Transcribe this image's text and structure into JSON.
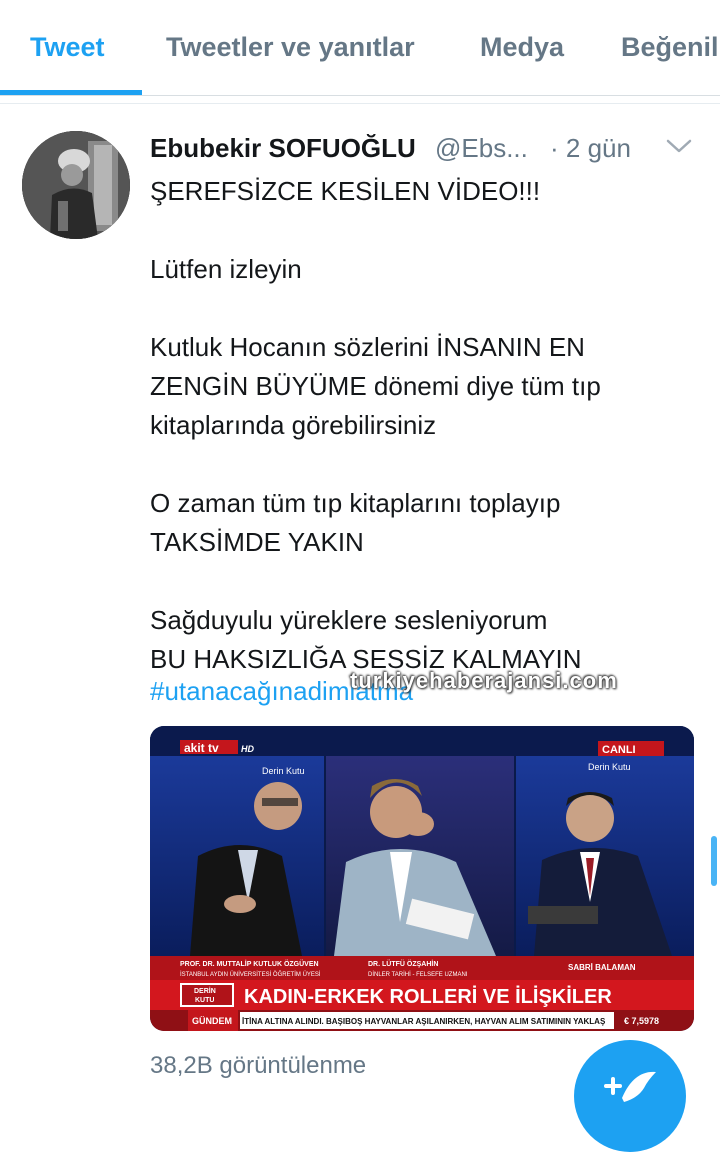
{
  "tabs": [
    {
      "label": "Tweet",
      "active": true
    },
    {
      "label": "Tweetler ve yanıtlar",
      "active": false
    },
    {
      "label": "Medya",
      "active": false
    },
    {
      "label": "Beğenil",
      "active": false
    }
  ],
  "tweet": {
    "author_name": "Ebubekir SOFUOĞLU",
    "handle": "@Ebs...",
    "time": "· 2 gün",
    "lines": [
      "ŞEREFSİZCE KESİLEN VİDEO!!!",
      "",
      "Lütfen izleyin",
      "",
      "Kutluk Hocanın sözlerini İNSANIN EN",
      "ZENGİN BÜYÜME dönemi diye tüm tıp",
      "kitaplarında görebilirsiniz",
      "",
      "O zaman tüm tıp kitaplarını toplayıp",
      "TAKSİMDE YAKIN",
      "",
      "Sağduyulu yüreklere sesleniyorum",
      "BU HAKSIZLIĞA SESSİZ KALMAYIN"
    ],
    "hashtag": "#utanacağınadimlatma",
    "views": "38,2B görüntülenme"
  },
  "watermark": "turkiyehaberajansi.com",
  "video": {
    "channel_logo": "akit tv",
    "hd": "HD",
    "live": "CANLI",
    "show": "Derin Kutu",
    "guest1_name": "PROF. DR. MUTTALİP KUTLUK ÖZGÜVEN",
    "guest1_title": "İSTANBUL AYDIN ÜNİVERSİTESİ ÖĞRETİM ÜYESİ",
    "guest2_name": "DR. LÜTFÜ ÖZŞAHİN",
    "guest2_title": "DİNLER TARİHİ - FELSEFE UZMANI",
    "host_name": "SABRİ BALAMAN",
    "box_line1": "DERİN",
    "box_line2": "KUTU",
    "headline": "KADIN-ERKEK ROLLERİ VE İLİŞKİLER",
    "ticker_label": "GÜNDEM",
    "ticker_text": "İTİNA ALTINA ALINDI. BAŞIBOŞ HAYVANLAR AŞILANIRKEN, HAYVAN ALIM SATIMININ YAKLAŞ",
    "euro": "€ 7,5978"
  },
  "colors": {
    "accent": "#1da1f2",
    "text": "#14171a",
    "muted": "#657786",
    "news_red": "#c4161c"
  },
  "icons": {
    "chevron": "chevron-down-icon",
    "compose": "compose-tweet-icon"
  }
}
